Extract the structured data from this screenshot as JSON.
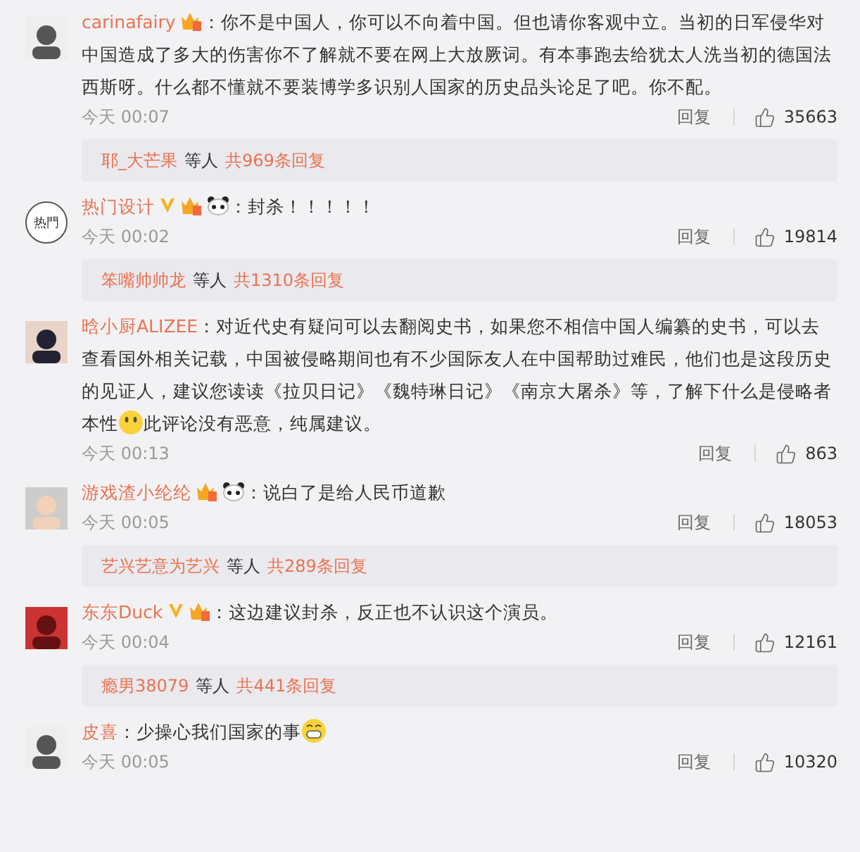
{
  "comments": [
    {
      "avatar": {
        "kind": "picture"
      },
      "name": "carinafairy",
      "badges": [
        {
          "kind": "vip"
        }
      ],
      "body": [
        {
          "kind": "text",
          "text": "：你不是中国人，你可以不向着中国。但也请你客观中立。当初的日军侵华对中国造成了多大的伤害你不了解就不要在网上大放厥词。有本事跑去给犹太人洗当初的德国法西斯呀。什么都不懂就不要装博学多识别人国家的历史品头论足了吧。你不配。"
        }
      ],
      "time": "今天 00:07",
      "reply_label": "回复",
      "likes": "35663",
      "replies": {
        "user": "耶_大芒果",
        "middle": "等人",
        "total": "共969条回复"
      }
    },
    {
      "avatar": {
        "kind": "logo",
        "text": "热門"
      },
      "name": "热门设计",
      "badges": [
        {
          "kind": "verified"
        },
        {
          "kind": "vip"
        },
        {
          "kind": "panda"
        }
      ],
      "body": [
        {
          "kind": "text",
          "text": "：封杀！！！！！"
        }
      ],
      "time": "今天 00:02",
      "reply_label": "回复",
      "likes": "19814",
      "replies": {
        "user": "笨嘴帅帅龙",
        "middle": "等人",
        "total": "共1310条回复"
      }
    },
    {
      "avatar": {
        "kind": "picture"
      },
      "name": "晗小厨ALIZEE",
      "body": [
        {
          "kind": "text",
          "text": "：对近代史有疑问可以去翻阅史书，如果您不相信中国人编纂的史书，可以去查看国外相关记载，中国被侵略期间也有不少国际友人在中国帮助过难民，他们也是这段历史的见证人，建议您读读《拉贝日记》《魏特琳日记》《南京大屠杀》等，了解下什么是侵略者本性"
        },
        {
          "kind": "smile"
        },
        {
          "kind": "text",
          "text": "此评论没有恶意，纯属建议。"
        }
      ],
      "time": "今天 00:13",
      "reply_label": "回复",
      "likes": "863"
    },
    {
      "avatar": {
        "kind": "picture"
      },
      "name": "游戏渣小纶纶",
      "badges": [
        {
          "kind": "vip"
        },
        {
          "kind": "panda"
        }
      ],
      "body": [
        {
          "kind": "text",
          "text": "：说白了是给人民币道歉"
        }
      ],
      "time": "今天 00:05",
      "reply_label": "回复",
      "likes": "18053",
      "replies": {
        "user": "艺兴艺意为艺兴",
        "middle": "等人",
        "total": "共289条回复"
      }
    },
    {
      "avatar": {
        "kind": "picture"
      },
      "name": "东东Duck",
      "badges": [
        {
          "kind": "verified"
        },
        {
          "kind": "vip"
        }
      ],
      "body": [
        {
          "kind": "text",
          "text": "：这边建议封杀，反正也不认识这个演员。"
        }
      ],
      "time": "今天 00:04",
      "reply_label": "回复",
      "likes": "12161",
      "replies": {
        "user": "瘾男38079",
        "middle": "等人",
        "total": "共441条回复"
      }
    },
    {
      "avatar": {
        "kind": "picture"
      },
      "name": "皮喜",
      "body": [
        {
          "kind": "text",
          "text": "：少操心我们国家的事"
        },
        {
          "kind": "grin"
        }
      ],
      "time": "今天 00:05",
      "reply_label": "回复",
      "likes": "10320"
    }
  ]
}
